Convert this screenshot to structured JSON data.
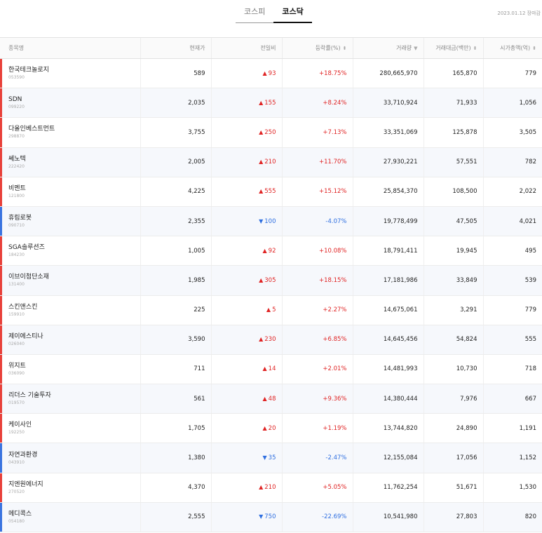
{
  "tabs": [
    {
      "label": "코스피",
      "active": false
    },
    {
      "label": "코스닥",
      "active": true
    }
  ],
  "date": "2023.01.12 장마감",
  "headers": {
    "name": "종목명",
    "price": "현재가",
    "change": "전일비",
    "rate": "등락률(%)",
    "volume": "거래량",
    "amount": "거래대금(백만)",
    "cap": "시가총액(억)"
  },
  "sort_icons": {
    "rate": "⬍",
    "volume": "▼",
    "amount": "⬍",
    "cap": "⬍"
  },
  "colors": {
    "up": "#e02424",
    "down": "#2f6fe0"
  },
  "rows": [
    {
      "name": "한국테크놀로지",
      "code": "053590",
      "price": "589",
      "dir": "up",
      "arrow": "▲",
      "change": "93",
      "rate": "+18.75%",
      "volume": "280,665,970",
      "amount": "165,870",
      "cap": "779"
    },
    {
      "name": "SDN",
      "code": "099220",
      "price": "2,035",
      "dir": "up",
      "arrow": "▲",
      "change": "155",
      "rate": "+8.24%",
      "volume": "33,710,924",
      "amount": "71,933",
      "cap": "1,056"
    },
    {
      "name": "다올인베스트먼트",
      "code": "298870",
      "price": "3,755",
      "dir": "up",
      "arrow": "▲",
      "change": "250",
      "rate": "+7.13%",
      "volume": "33,351,069",
      "amount": "125,878",
      "cap": "3,505"
    },
    {
      "name": "쎄노텍",
      "code": "222420",
      "price": "2,005",
      "dir": "up",
      "arrow": "▲",
      "change": "210",
      "rate": "+11.70%",
      "volume": "27,930,221",
      "amount": "57,551",
      "cap": "782"
    },
    {
      "name": "비멘트",
      "code": "121800",
      "price": "4,225",
      "dir": "up",
      "arrow": "▲",
      "change": "555",
      "rate": "+15.12%",
      "volume": "25,854,370",
      "amount": "108,500",
      "cap": "2,022"
    },
    {
      "name": "휴림로봇",
      "code": "090710",
      "price": "2,355",
      "dir": "down",
      "arrow": "▼",
      "change": "100",
      "rate": "-4.07%",
      "volume": "19,778,499",
      "amount": "47,505",
      "cap": "4,021"
    },
    {
      "name": "SGA솔루션즈",
      "code": "184230",
      "price": "1,005",
      "dir": "up",
      "arrow": "▲",
      "change": "92",
      "rate": "+10.08%",
      "volume": "18,791,411",
      "amount": "19,945",
      "cap": "495"
    },
    {
      "name": "이브이첨단소재",
      "code": "131400",
      "price": "1,985",
      "dir": "up",
      "arrow": "▲",
      "change": "305",
      "rate": "+18.15%",
      "volume": "17,181,986",
      "amount": "33,849",
      "cap": "539"
    },
    {
      "name": "스킨앤스킨",
      "code": "159910",
      "price": "225",
      "dir": "up",
      "arrow": "▲",
      "change": "5",
      "rate": "+2.27%",
      "volume": "14,675,061",
      "amount": "3,291",
      "cap": "779"
    },
    {
      "name": "제이에스티나",
      "code": "026040",
      "price": "3,590",
      "dir": "up",
      "arrow": "▲",
      "change": "230",
      "rate": "+6.85%",
      "volume": "14,645,456",
      "amount": "54,824",
      "cap": "555"
    },
    {
      "name": "위지트",
      "code": "036090",
      "price": "711",
      "dir": "up",
      "arrow": "▲",
      "change": "14",
      "rate": "+2.01%",
      "volume": "14,481,993",
      "amount": "10,730",
      "cap": "718"
    },
    {
      "name": "리더스 기술투자",
      "code": "019570",
      "price": "561",
      "dir": "up",
      "arrow": "▲",
      "change": "48",
      "rate": "+9.36%",
      "volume": "14,380,444",
      "amount": "7,976",
      "cap": "667"
    },
    {
      "name": "케이사인",
      "code": "192250",
      "price": "1,705",
      "dir": "up",
      "arrow": "▲",
      "change": "20",
      "rate": "+1.19%",
      "volume": "13,744,820",
      "amount": "24,890",
      "cap": "1,191"
    },
    {
      "name": "자연과환경",
      "code": "043910",
      "price": "1,380",
      "dir": "down",
      "arrow": "▼",
      "change": "35",
      "rate": "-2.47%",
      "volume": "12,155,084",
      "amount": "17,056",
      "cap": "1,152"
    },
    {
      "name": "지엔원에너지",
      "code": "270520",
      "price": "4,370",
      "dir": "up",
      "arrow": "▲",
      "change": "210",
      "rate": "+5.05%",
      "volume": "11,762,254",
      "amount": "51,671",
      "cap": "1,530"
    },
    {
      "name": "메디콕스",
      "code": "054180",
      "price": "2,555",
      "dir": "down",
      "arrow": "▼",
      "change": "750",
      "rate": "-22.69%",
      "volume": "10,541,980",
      "amount": "27,803",
      "cap": "820"
    }
  ]
}
